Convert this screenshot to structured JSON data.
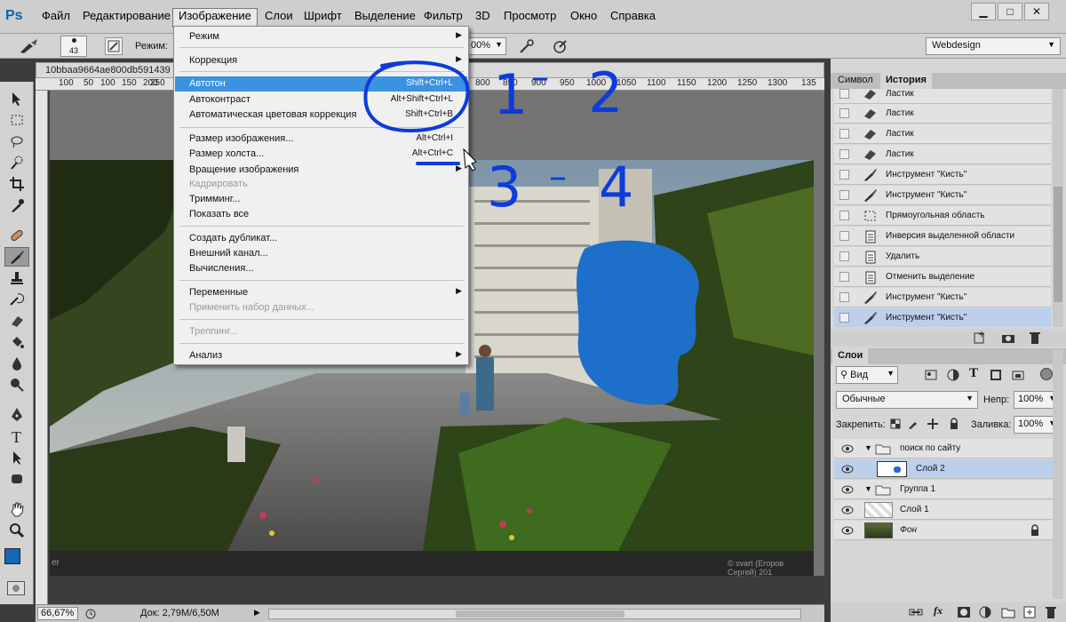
{
  "menubar": {
    "logo": "Ps",
    "items": [
      "Файл",
      "Редактирование",
      "Изображение",
      "Слои",
      "Шрифт",
      "Выделение",
      "Фильтр",
      "3D",
      "Просмотр",
      "Окно",
      "Справка"
    ]
  },
  "options": {
    "brush_size": "43",
    "mode_label": "Режим:",
    "zoom_value": "00%",
    "workspace": "Webdesign"
  },
  "document": {
    "tab": "10bbaa9664ae800db591439",
    "ruler_left": [
      "100",
      "50",
      "100",
      "150",
      "200",
      "250"
    ],
    "ruler_right": [
      "800",
      "850",
      "900",
      "950",
      "1000",
      "1050",
      "1100",
      "1150",
      "1200",
      "1250",
      "1300",
      "135"
    ],
    "credit": "© svart (Егоров Сергей) 201",
    "corner_text": "er"
  },
  "status": {
    "zoom": "66,67%",
    "doc": "Док: 2,79M/6,50M"
  },
  "image_menu": {
    "items": [
      {
        "label": "Режим",
        "shortcut": "",
        "arrow": "▶",
        "state": "normal"
      },
      {
        "label": "Коррекция",
        "shortcut": "",
        "arrow": "▶",
        "state": "normal"
      },
      {
        "label": "Автотон",
        "shortcut": "Shift+Ctrl+L",
        "arrow": "",
        "state": "highlight"
      },
      {
        "label": "Автоконтраст",
        "shortcut": "Alt+Shift+Ctrl+L",
        "arrow": "",
        "state": "normal"
      },
      {
        "label": "Автоматическая цветовая коррекция",
        "shortcut": "Shift+Ctrl+B",
        "arrow": "",
        "state": "normal"
      },
      {
        "label": "Размер изображения...",
        "shortcut": "Alt+Ctrl+I",
        "arrow": "",
        "state": "normal"
      },
      {
        "label": "Размер холста...",
        "shortcut": "Alt+Ctrl+C",
        "arrow": "",
        "state": "normal"
      },
      {
        "label": "Вращение изображения",
        "shortcut": "",
        "arrow": "▶",
        "state": "normal"
      },
      {
        "label": "Кадрировать",
        "shortcut": "",
        "arrow": "",
        "state": "disabled"
      },
      {
        "label": "Тримминг...",
        "shortcut": "",
        "arrow": "",
        "state": "normal"
      },
      {
        "label": "Показать все",
        "shortcut": "",
        "arrow": "",
        "state": "normal"
      },
      {
        "label": "Создать дубликат...",
        "shortcut": "",
        "arrow": "",
        "state": "normal"
      },
      {
        "label": "Внешний канал...",
        "shortcut": "",
        "arrow": "",
        "state": "normal"
      },
      {
        "label": "Вычисления...",
        "shortcut": "",
        "arrow": "",
        "state": "normal"
      },
      {
        "label": "Переменные",
        "shortcut": "",
        "arrow": "▶",
        "state": "normal"
      },
      {
        "label": "Применить набор данных...",
        "shortcut": "",
        "arrow": "",
        "state": "disabled"
      },
      {
        "label": "Треппинг...",
        "shortcut": "",
        "arrow": "",
        "state": "disabled"
      },
      {
        "label": "Анализ",
        "shortcut": "",
        "arrow": "▶",
        "state": "normal"
      }
    ]
  },
  "history_panel": {
    "tabs": [
      "Символ",
      "История"
    ],
    "rows": [
      {
        "label": "Ластик",
        "icon": "eraser-icon"
      },
      {
        "label": "Ластик",
        "icon": "eraser-icon"
      },
      {
        "label": "Ластик",
        "icon": "eraser-icon"
      },
      {
        "label": "Ластик",
        "icon": "eraser-icon"
      },
      {
        "label": "Инструмент \"Кисть\"",
        "icon": "brush-icon"
      },
      {
        "label": "Инструмент \"Кисть\"",
        "icon": "brush-icon"
      },
      {
        "label": "Прямоугольная область",
        "icon": "marquee-icon"
      },
      {
        "label": "Инверсия выделенной области",
        "icon": "document-icon"
      },
      {
        "label": "Удалить",
        "icon": "document-icon"
      },
      {
        "label": "Отменить выделение",
        "icon": "document-icon"
      },
      {
        "label": "Инструмент \"Кисть\"",
        "icon": "brush-icon"
      },
      {
        "label": "Инструмент \"Кисть\"",
        "icon": "brush-icon"
      }
    ]
  },
  "layers_panel": {
    "tab": "Слои",
    "filter": "Вид",
    "blend_mode": "Обычные",
    "opacity_label": "Непр:",
    "opacity": "100%",
    "lock_label": "Закрепить:",
    "fill_label": "Заливка:",
    "fill": "100%",
    "layers": [
      {
        "name": "поиск по сайту",
        "kind": "group"
      },
      {
        "name": "Слой 2",
        "kind": "layer"
      },
      {
        "name": "Группа 1",
        "kind": "group"
      },
      {
        "name": "Слой 1",
        "kind": "layer"
      },
      {
        "name": "Фон",
        "kind": "background"
      }
    ]
  },
  "annotations": [
    "1",
    "–",
    "2",
    "3",
    "–",
    "4"
  ],
  "colors": {
    "accent": "#3a92e0",
    "marker": "#0d3bdc",
    "blue_blob": "#1e6fc9",
    "foreground": "#1467b8"
  }
}
